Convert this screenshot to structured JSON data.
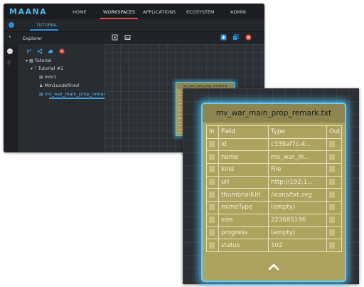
{
  "app": {
    "logo": "MAANA",
    "nav": [
      "HOME",
      "WORKSPACES",
      "APPLICATIONS",
      "ECOSYSTEM",
      "ADMIN"
    ],
    "active_nav": "WORKSPACES",
    "tab_label": "TUTORIAL",
    "explorer_title": "Explorer",
    "tree": {
      "root": "Tutorial",
      "child": "Tutorial #1",
      "items": [
        "mm1",
        "Mm1undefined",
        "mv_war_main_prop_remar"
      ]
    }
  },
  "node": {
    "title": "mv_war_main_prop_remark.txt",
    "columns": [
      "In",
      "Field",
      "Type",
      "Out"
    ],
    "rows": [
      {
        "field": "id",
        "type": "c339af7c-4..."
      },
      {
        "field": "name",
        "type": "mv_war_m..."
      },
      {
        "field": "kind",
        "type": "File"
      },
      {
        "field": "url",
        "type": "http://192.1..."
      },
      {
        "field": "thumbnailUrl",
        "type": "/icons/txt.svg"
      },
      {
        "field": "mimeType",
        "type": "(empty)"
      },
      {
        "field": "size",
        "type": "223685196"
      },
      {
        "field": "progress",
        "type": "(empty)"
      },
      {
        "field": "status",
        "type": "102"
      }
    ]
  },
  "colors": {
    "accent_blue": "#2b8ed8",
    "node_body": "#ada35f",
    "node_header": "#8d854f",
    "selection_glow": "#5fd0ff",
    "active_underline": "#e24a3b"
  },
  "icons": [
    "back-icon",
    "compass-icon",
    "search-icon",
    "add-icon",
    "copy-icon",
    "close-icon",
    "share-icon",
    "upload-icon",
    "collapse-icon"
  ]
}
